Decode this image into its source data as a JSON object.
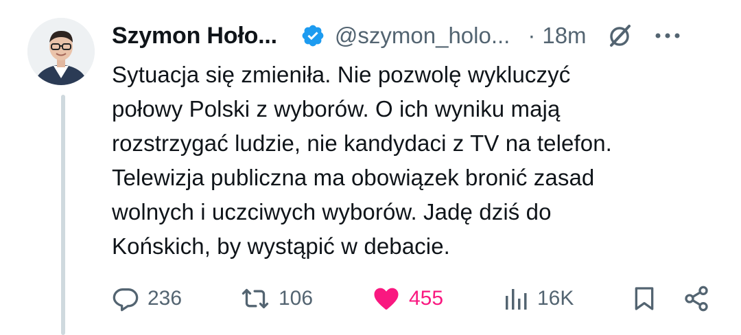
{
  "author": {
    "name": "Szymon Hoło...",
    "handle": "@szymon_holo...",
    "separator": "·",
    "time": "18m",
    "verified_color": "#1d9bf0"
  },
  "tweet": {
    "lines": [
      "Sytuacja się zmieniła. Nie pozwolę wykluczyć",
      "połowy Polski z wyborów. O ich wyniku mają",
      "rozstrzygać ludzie, nie kandydaci z TV na telefon.",
      "Telewizja publiczna ma obowiązek bronić zasad",
      "wolnych i uczciwych wyborów. Jadę dziś do",
      "Końskich, by wystąpić w debacie."
    ]
  },
  "actions": {
    "replies": "236",
    "reposts": "106",
    "likes": "455",
    "views": "16K",
    "like_color": "#f91880",
    "muted_color": "#536471"
  },
  "icons": [
    "reply-icon",
    "repost-icon",
    "like-icon",
    "views-icon",
    "bookmark-icon",
    "share-icon",
    "grok-icon",
    "more-icon",
    "verified-icon"
  ]
}
